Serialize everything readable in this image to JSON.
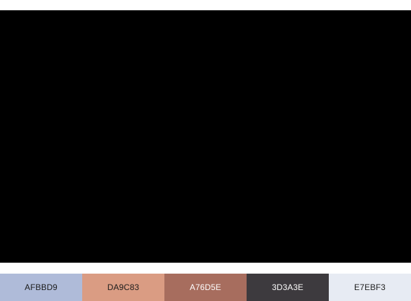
{
  "preview": {
    "color": "#000000"
  },
  "palette": {
    "swatches": [
      {
        "hex": "AFBBD9",
        "color": "#AFBBD9",
        "text_color": "#1a1a1a"
      },
      {
        "hex": "DA9C83",
        "color": "#DA9C83",
        "text_color": "#1a1a1a"
      },
      {
        "hex": "A76D5E",
        "color": "#A76D5E",
        "text_color": "#ffffff"
      },
      {
        "hex": "3D3A3E",
        "color": "#3D3A3E",
        "text_color": "#ffffff"
      },
      {
        "hex": "E7EBF3",
        "color": "#E7EBF3",
        "text_color": "#1a1a1a"
      }
    ]
  }
}
